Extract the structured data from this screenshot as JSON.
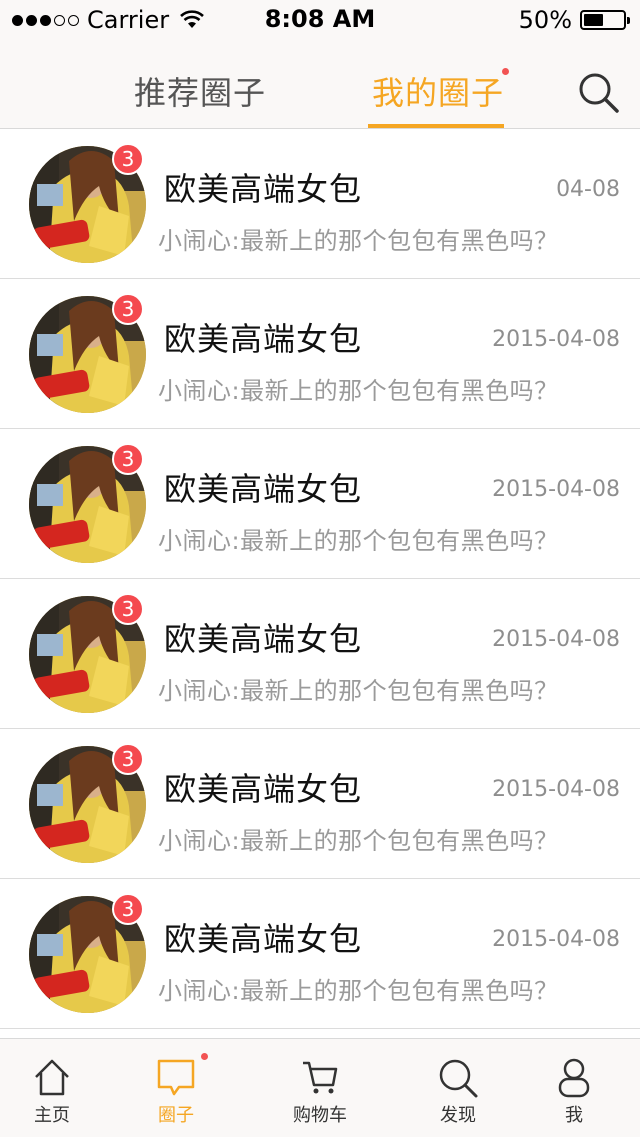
{
  "status_bar": {
    "carrier": "Carrier",
    "time": "8:08 AM",
    "battery": "50%",
    "battery_level": 0.5
  },
  "top_nav": {
    "tabs": [
      {
        "label": "推荐圈子",
        "active": false
      },
      {
        "label": "我的圈子",
        "active": true,
        "has_dot": true
      }
    ],
    "search_icon": "search-icon"
  },
  "colors": {
    "accent": "#f5a623",
    "badge": "#f4494e",
    "notify_dot": "#f25353"
  },
  "list": [
    {
      "title": "欧美高端女包",
      "date": "04-08",
      "sender": "小闹心",
      "separator": ":",
      "message": "最新上的那个包包有黑色吗？",
      "badge": "3"
    },
    {
      "title": "欧美高端女包",
      "date": "2015-04-08",
      "sender": "小闹心",
      "separator": ":",
      "message": "最新上的那个包包有黑色吗？",
      "badge": "3"
    },
    {
      "title": "欧美高端女包",
      "date": "2015-04-08",
      "sender": "小闹心",
      "separator": ":",
      "message": "最新上的那个包包有黑色吗？",
      "badge": "3"
    },
    {
      "title": "欧美高端女包",
      "date": "2015-04-08",
      "sender": "小闹心",
      "separator": ":",
      "message": "最新上的那个包包有黑色吗？",
      "badge": "3"
    },
    {
      "title": "欧美高端女包",
      "date": "2015-04-08",
      "sender": "小闹心",
      "separator": ":",
      "message": "最新上的那个包包有黑色吗？",
      "badge": "3"
    },
    {
      "title": "欧美高端女包",
      "date": "2015-04-08",
      "sender": "小闹心",
      "separator": ":",
      "message": "最新上的那个包包有黑色吗？",
      "badge": "3"
    }
  ],
  "tab_bar": {
    "items": [
      {
        "label": "主页",
        "icon": "home-icon",
        "active": false
      },
      {
        "label": "圈子",
        "icon": "chat-bubble-icon",
        "active": true,
        "has_dot": true
      },
      {
        "label": "购物车",
        "icon": "cart-icon",
        "active": false
      },
      {
        "label": "发现",
        "icon": "search-icon",
        "active": false
      },
      {
        "label": "我",
        "icon": "user-icon",
        "active": false
      }
    ]
  }
}
